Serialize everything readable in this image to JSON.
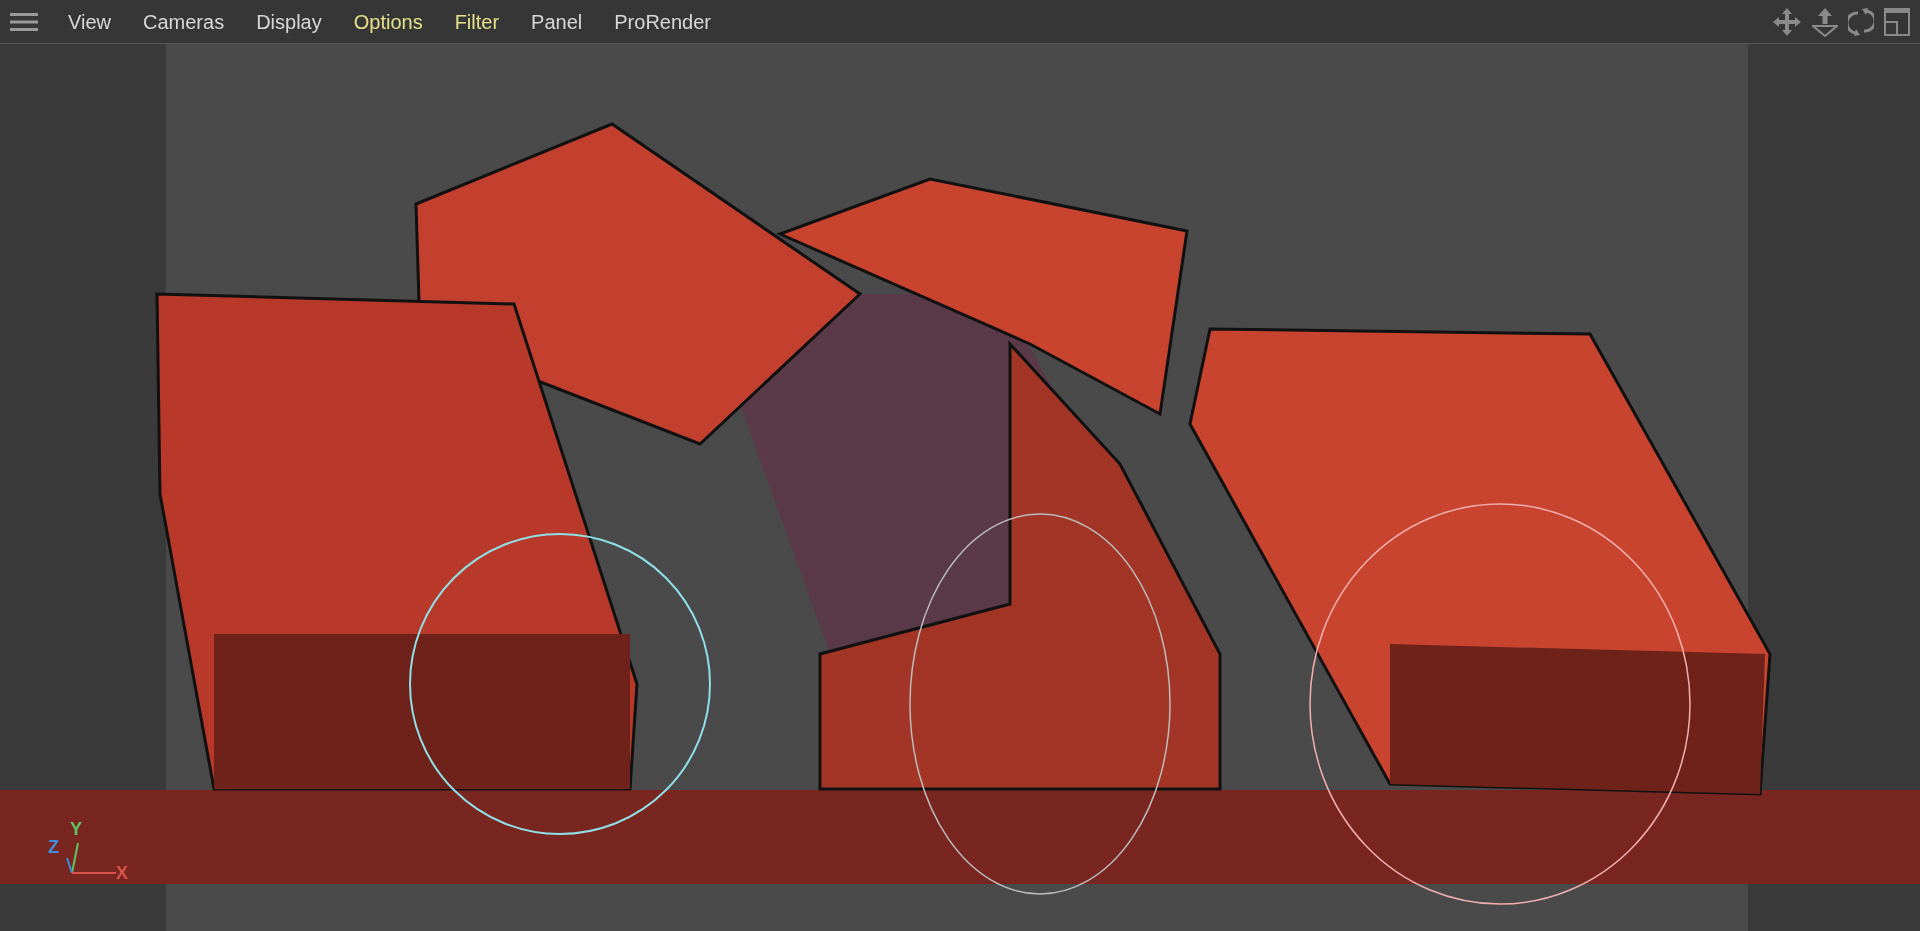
{
  "menu": {
    "items": [
      {
        "label": "View",
        "highlighted": false
      },
      {
        "label": "Cameras",
        "highlighted": false
      },
      {
        "label": "Display",
        "highlighted": false
      },
      {
        "label": "Options",
        "highlighted": true
      },
      {
        "label": "Filter",
        "highlighted": true
      },
      {
        "label": "Panel",
        "highlighted": false
      },
      {
        "label": "ProRender",
        "highlighted": false
      }
    ]
  },
  "viewport": {
    "axis_labels": [
      {
        "label": "Y",
        "color": "#5fc45f"
      },
      {
        "label": "Z",
        "color": "#3f8fe0"
      },
      {
        "label": "X",
        "color": "#d9534a"
      }
    ]
  }
}
